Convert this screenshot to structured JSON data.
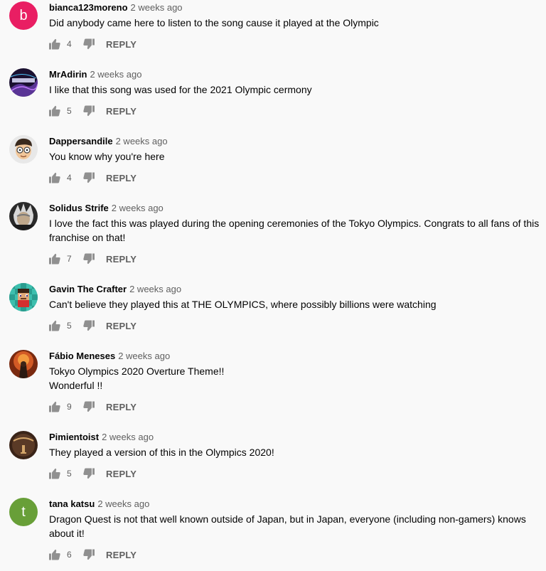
{
  "colors": {
    "avatar_b": "#e91e63",
    "avatar_t": "#689f38",
    "icon": "#909090",
    "secondary_text": "#606060"
  },
  "comments": [
    {
      "author": "bianca123moreno",
      "time": "2 weeks ago",
      "text": "Did anybody came here to listen to the song cause it played at the Olympic",
      "likes": "4",
      "reply": "REPLY",
      "avatar_letter": "b"
    },
    {
      "author": "MrAdirin",
      "time": "2 weeks ago",
      "text": "I like that this song was used for the 2021 Olympic cermony",
      "likes": "5",
      "reply": "REPLY"
    },
    {
      "author": "Dappersandile",
      "time": "2 weeks ago",
      "text": "You know why you're here",
      "likes": "4",
      "reply": "REPLY"
    },
    {
      "author": "Solidus Strife",
      "time": "2 weeks ago",
      "text": "I love the fact this was played during the opening ceremonies of the Tokyo Olympics. Congrats to all fans of this franchise on that!",
      "likes": "7",
      "reply": "REPLY"
    },
    {
      "author": "Gavin The Crafter",
      "time": "2 weeks ago",
      "text": "Can't believe they played this at THE OLYMPICS, where possibly billions were watching",
      "likes": "5",
      "reply": "REPLY"
    },
    {
      "author": "Fábio Meneses",
      "time": "2 weeks ago",
      "text_line1": "Tokyo Olympics 2020 Overture Theme!!",
      "text_line2": "Wonderful !!",
      "likes": "9",
      "reply": "REPLY"
    },
    {
      "author": "Pimientoist",
      "time": "2 weeks ago",
      "text": "They played a version of this in the Olympics 2020!",
      "likes": "5",
      "reply": "REPLY"
    },
    {
      "author": "tana katsu",
      "time": "2 weeks ago",
      "text": "Dragon Quest is not that well known outside of Japan, but in Japan, everyone (including non-gamers) knows about it!",
      "likes": "6",
      "reply": "REPLY",
      "avatar_letter": "t"
    }
  ]
}
